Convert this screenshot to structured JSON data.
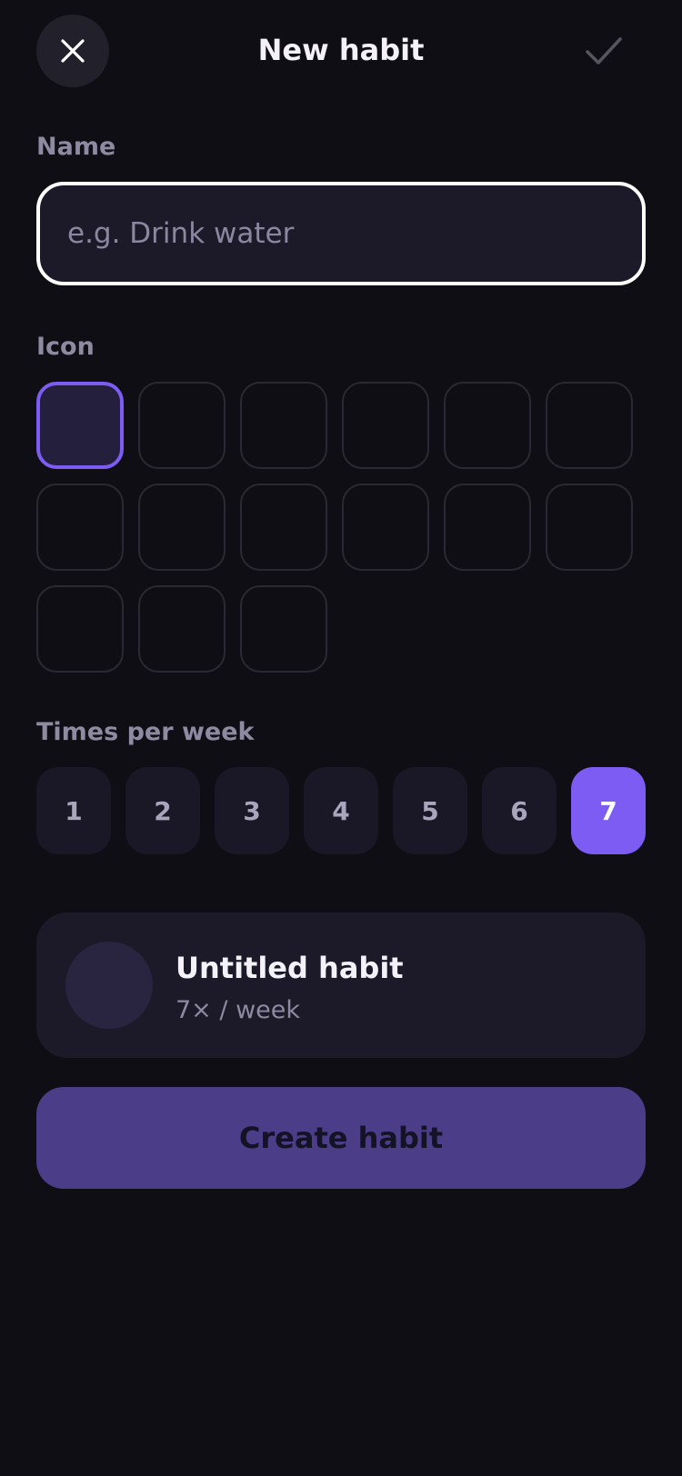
{
  "header": {
    "title": "New habit",
    "close_icon": "close-icon",
    "confirm_icon": "checkmark-icon"
  },
  "name_section": {
    "label": "Name",
    "value": "",
    "placeholder": "e.g. Drink water"
  },
  "icon_section": {
    "label": "Icon",
    "cell_count": 15,
    "selected_index": 0
  },
  "times_section": {
    "label": "Times per week",
    "options": [
      "1",
      "2",
      "3",
      "4",
      "5",
      "6",
      "7"
    ],
    "selected": "7"
  },
  "preview": {
    "title": "Untitled habit",
    "subtitle": "7× / week"
  },
  "create_button": {
    "label": "Create habit"
  },
  "colors": {
    "background": "#0f0e14",
    "accent": "#7c5cf3",
    "card": "#1c1a29",
    "create_button": "#4c3d88"
  }
}
